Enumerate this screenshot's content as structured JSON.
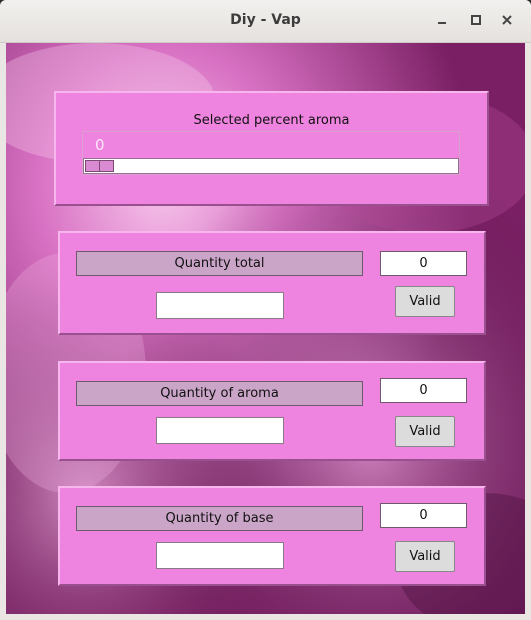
{
  "window": {
    "title": "Diy - Vap",
    "minimize_icon": "minimize-icon",
    "maximize_icon": "maximize-icon",
    "close_icon": "close-icon"
  },
  "aroma_scale": {
    "label": "Selected percent aroma",
    "value": "0",
    "level": 0
  },
  "sections": [
    {
      "label": "Quantity total",
      "result": "0",
      "input_value": "",
      "button": "Valid"
    },
    {
      "label": "Quantity of aroma",
      "result": "0",
      "input_value": "",
      "button": "Valid"
    },
    {
      "label": "Quantity of base",
      "result": "0",
      "input_value": "",
      "button": "Valid"
    }
  ],
  "colors": {
    "panel": "#ef84e0",
    "label_bg": "#caa5c8",
    "background_primary": "#b5358f"
  }
}
